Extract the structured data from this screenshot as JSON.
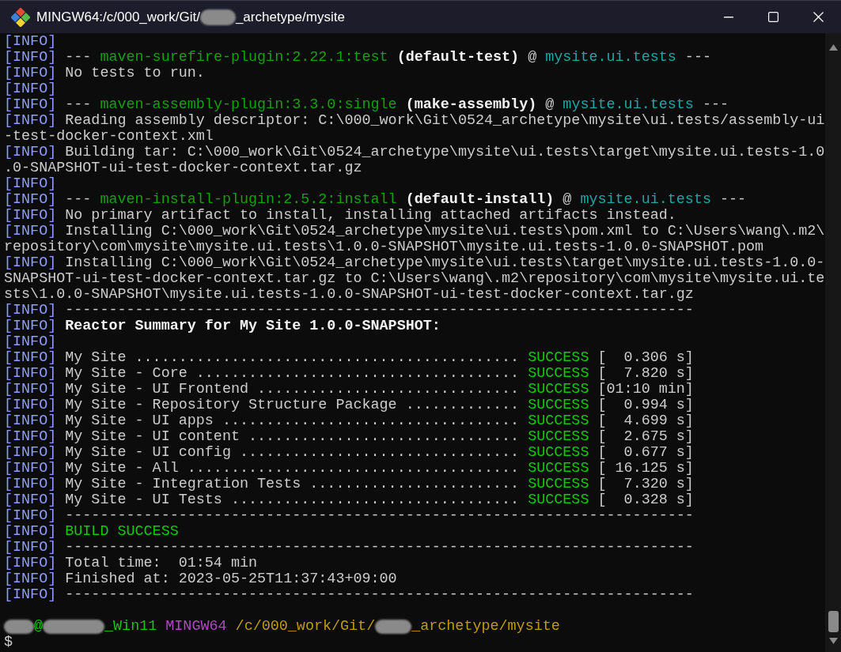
{
  "window": {
    "title": [
      {
        "kind": "text",
        "text": "MINGW64:/c/000_work/Git/"
      },
      {
        "kind": "redacted"
      },
      {
        "kind": "text",
        "text": "_archetype/mysite"
      }
    ]
  },
  "terminal": {
    "lines": [
      [
        {
          "kind": "tag",
          "text": "[INFO]"
        }
      ],
      [
        {
          "kind": "tag",
          "text": "[INFO]"
        },
        {
          "kind": "plain",
          "text": " --- "
        },
        {
          "kind": "plugin",
          "text": "maven-surefire-plugin:2.22.1:test"
        },
        {
          "kind": "goal",
          "text": " (default-test)"
        },
        {
          "kind": "plain",
          "text": " @ "
        },
        {
          "kind": "artifact",
          "text": "mysite.ui.tests"
        },
        {
          "kind": "plain",
          "text": " ---"
        }
      ],
      [
        {
          "kind": "tag",
          "text": "[INFO]"
        },
        {
          "kind": "plain",
          "text": " No tests to run."
        }
      ],
      [
        {
          "kind": "tag",
          "text": "[INFO]"
        }
      ],
      [
        {
          "kind": "tag",
          "text": "[INFO]"
        },
        {
          "kind": "plain",
          "text": " --- "
        },
        {
          "kind": "plugin",
          "text": "maven-assembly-plugin:3.3.0:single"
        },
        {
          "kind": "goal",
          "text": " (make-assembly)"
        },
        {
          "kind": "plain",
          "text": " @ "
        },
        {
          "kind": "artifact",
          "text": "mysite.ui.tests"
        },
        {
          "kind": "plain",
          "text": " ---"
        }
      ],
      [
        {
          "kind": "tag",
          "text": "[INFO]"
        },
        {
          "kind": "plain",
          "text": " Reading assembly descriptor: C:\\000_work\\Git\\0524_archetype\\mysite\\ui.tests/assembly-ui"
        }
      ],
      [
        {
          "kind": "plain",
          "text": "-test-docker-context.xml"
        }
      ],
      [
        {
          "kind": "tag",
          "text": "[INFO]"
        },
        {
          "kind": "plain",
          "text": " Building tar: C:\\000_work\\Git\\0524_archetype\\mysite\\ui.tests\\target\\mysite.ui.tests-1.0"
        }
      ],
      [
        {
          "kind": "plain",
          "text": ".0-SNAPSHOT-ui-test-docker-context.tar.gz"
        }
      ],
      [
        {
          "kind": "tag",
          "text": "[INFO]"
        }
      ],
      [
        {
          "kind": "tag",
          "text": "[INFO]"
        },
        {
          "kind": "plain",
          "text": " --- "
        },
        {
          "kind": "plugin",
          "text": "maven-install-plugin:2.5.2:install"
        },
        {
          "kind": "goal",
          "text": " (default-install)"
        },
        {
          "kind": "plain",
          "text": " @ "
        },
        {
          "kind": "artifact",
          "text": "mysite.ui.tests"
        },
        {
          "kind": "plain",
          "text": " ---"
        }
      ],
      [
        {
          "kind": "tag",
          "text": "[INFO]"
        },
        {
          "kind": "plain",
          "text": " No primary artifact to install, installing attached artifacts instead."
        }
      ],
      [
        {
          "kind": "tag",
          "text": "[INFO]"
        },
        {
          "kind": "plain",
          "text": " Installing C:\\000_work\\Git\\0524_archetype\\mysite\\ui.tests\\pom.xml to C:\\Users\\wang\\.m2\\"
        }
      ],
      [
        {
          "kind": "plain",
          "text": "repository\\com\\mysite\\mysite.ui.tests\\1.0.0-SNAPSHOT\\mysite.ui.tests-1.0.0-SNAPSHOT.pom"
        }
      ],
      [
        {
          "kind": "tag",
          "text": "[INFO]"
        },
        {
          "kind": "plain",
          "text": " Installing C:\\000_work\\Git\\0524_archetype\\mysite\\ui.tests\\target\\mysite.ui.tests-1.0.0-"
        }
      ],
      [
        {
          "kind": "plain",
          "text": "SNAPSHOT-ui-test-docker-context.tar.gz to C:\\Users\\wang\\.m2\\repository\\com\\mysite\\mysite.ui.te"
        }
      ],
      [
        {
          "kind": "plain",
          "text": "sts\\1.0.0-SNAPSHOT\\mysite.ui.tests-1.0.0-SNAPSHOT-ui-test-docker-context.tar.gz"
        }
      ],
      [
        {
          "kind": "tag",
          "text": "[INFO]"
        },
        {
          "kind": "plain",
          "text": " ------------------------------------------------------------------------"
        }
      ],
      [
        {
          "kind": "tag",
          "text": "[INFO]"
        },
        {
          "kind": "goal",
          "text": " Reactor Summary for My Site 1.0.0-SNAPSHOT:"
        }
      ],
      [
        {
          "kind": "tag",
          "text": "[INFO]"
        }
      ],
      [
        {
          "kind": "tag",
          "text": "[INFO]"
        },
        {
          "kind": "plain",
          "text": " My Site ............................................ "
        },
        {
          "kind": "success",
          "text": "SUCCESS"
        },
        {
          "kind": "plain",
          "text": " [  0.306 s]"
        }
      ],
      [
        {
          "kind": "tag",
          "text": "[INFO]"
        },
        {
          "kind": "plain",
          "text": " My Site - Core ..................................... "
        },
        {
          "kind": "success",
          "text": "SUCCESS"
        },
        {
          "kind": "plain",
          "text": " [  7.820 s]"
        }
      ],
      [
        {
          "kind": "tag",
          "text": "[INFO]"
        },
        {
          "kind": "plain",
          "text": " My Site - UI Frontend .............................. "
        },
        {
          "kind": "success",
          "text": "SUCCESS"
        },
        {
          "kind": "plain",
          "text": " [01:10 min]"
        }
      ],
      [
        {
          "kind": "tag",
          "text": "[INFO]"
        },
        {
          "kind": "plain",
          "text": " My Site - Repository Structure Package ............. "
        },
        {
          "kind": "success",
          "text": "SUCCESS"
        },
        {
          "kind": "plain",
          "text": " [  0.994 s]"
        }
      ],
      [
        {
          "kind": "tag",
          "text": "[INFO]"
        },
        {
          "kind": "plain",
          "text": " My Site - UI apps .................................. "
        },
        {
          "kind": "success",
          "text": "SUCCESS"
        },
        {
          "kind": "plain",
          "text": " [  4.699 s]"
        }
      ],
      [
        {
          "kind": "tag",
          "text": "[INFO]"
        },
        {
          "kind": "plain",
          "text": " My Site - UI content ............................... "
        },
        {
          "kind": "success",
          "text": "SUCCESS"
        },
        {
          "kind": "plain",
          "text": " [  2.675 s]"
        }
      ],
      [
        {
          "kind": "tag",
          "text": "[INFO]"
        },
        {
          "kind": "plain",
          "text": " My Site - UI config ................................ "
        },
        {
          "kind": "success",
          "text": "SUCCESS"
        },
        {
          "kind": "plain",
          "text": " [  0.677 s]"
        }
      ],
      [
        {
          "kind": "tag",
          "text": "[INFO]"
        },
        {
          "kind": "plain",
          "text": " My Site - All ...................................... "
        },
        {
          "kind": "success",
          "text": "SUCCESS"
        },
        {
          "kind": "plain",
          "text": " [ 16.125 s]"
        }
      ],
      [
        {
          "kind": "tag",
          "text": "[INFO]"
        },
        {
          "kind": "plain",
          "text": " My Site - Integration Tests ........................ "
        },
        {
          "kind": "success",
          "text": "SUCCESS"
        },
        {
          "kind": "plain",
          "text": " [  7.320 s]"
        }
      ],
      [
        {
          "kind": "tag",
          "text": "[INFO]"
        },
        {
          "kind": "plain",
          "text": " My Site - UI Tests ................................. "
        },
        {
          "kind": "success",
          "text": "SUCCESS"
        },
        {
          "kind": "plain",
          "text": " [  0.328 s]"
        }
      ],
      [
        {
          "kind": "tag",
          "text": "[INFO]"
        },
        {
          "kind": "plain",
          "text": " ------------------------------------------------------------------------"
        }
      ],
      [
        {
          "kind": "tag",
          "text": "[INFO]"
        },
        {
          "kind": "success",
          "text": " BUILD SUCCESS"
        }
      ],
      [
        {
          "kind": "tag",
          "text": "[INFO]"
        },
        {
          "kind": "plain",
          "text": " ------------------------------------------------------------------------"
        }
      ],
      [
        {
          "kind": "tag",
          "text": "[INFO]"
        },
        {
          "kind": "plain",
          "text": " Total time:  01:54 min"
        }
      ],
      [
        {
          "kind": "tag",
          "text": "[INFO]"
        },
        {
          "kind": "plain",
          "text": " Finished at: 2023-05-25T11:37:43+09:00"
        }
      ],
      [
        {
          "kind": "tag",
          "text": "[INFO]"
        },
        {
          "kind": "plain",
          "text": " ------------------------------------------------------------------------"
        }
      ]
    ],
    "prompt": [
      {
        "kind": "redacted"
      },
      {
        "kind": "user",
        "text": "@"
      },
      {
        "kind": "redacted"
      },
      {
        "kind": "user",
        "text": "_Win11"
      },
      {
        "kind": "system",
        "text": " MINGW64"
      },
      {
        "kind": "path",
        "text": " /c/000_work/Git/"
      },
      {
        "kind": "redacted"
      },
      {
        "kind": "path",
        "text": "_archetype/mysite"
      }
    ],
    "input_line": "$"
  }
}
